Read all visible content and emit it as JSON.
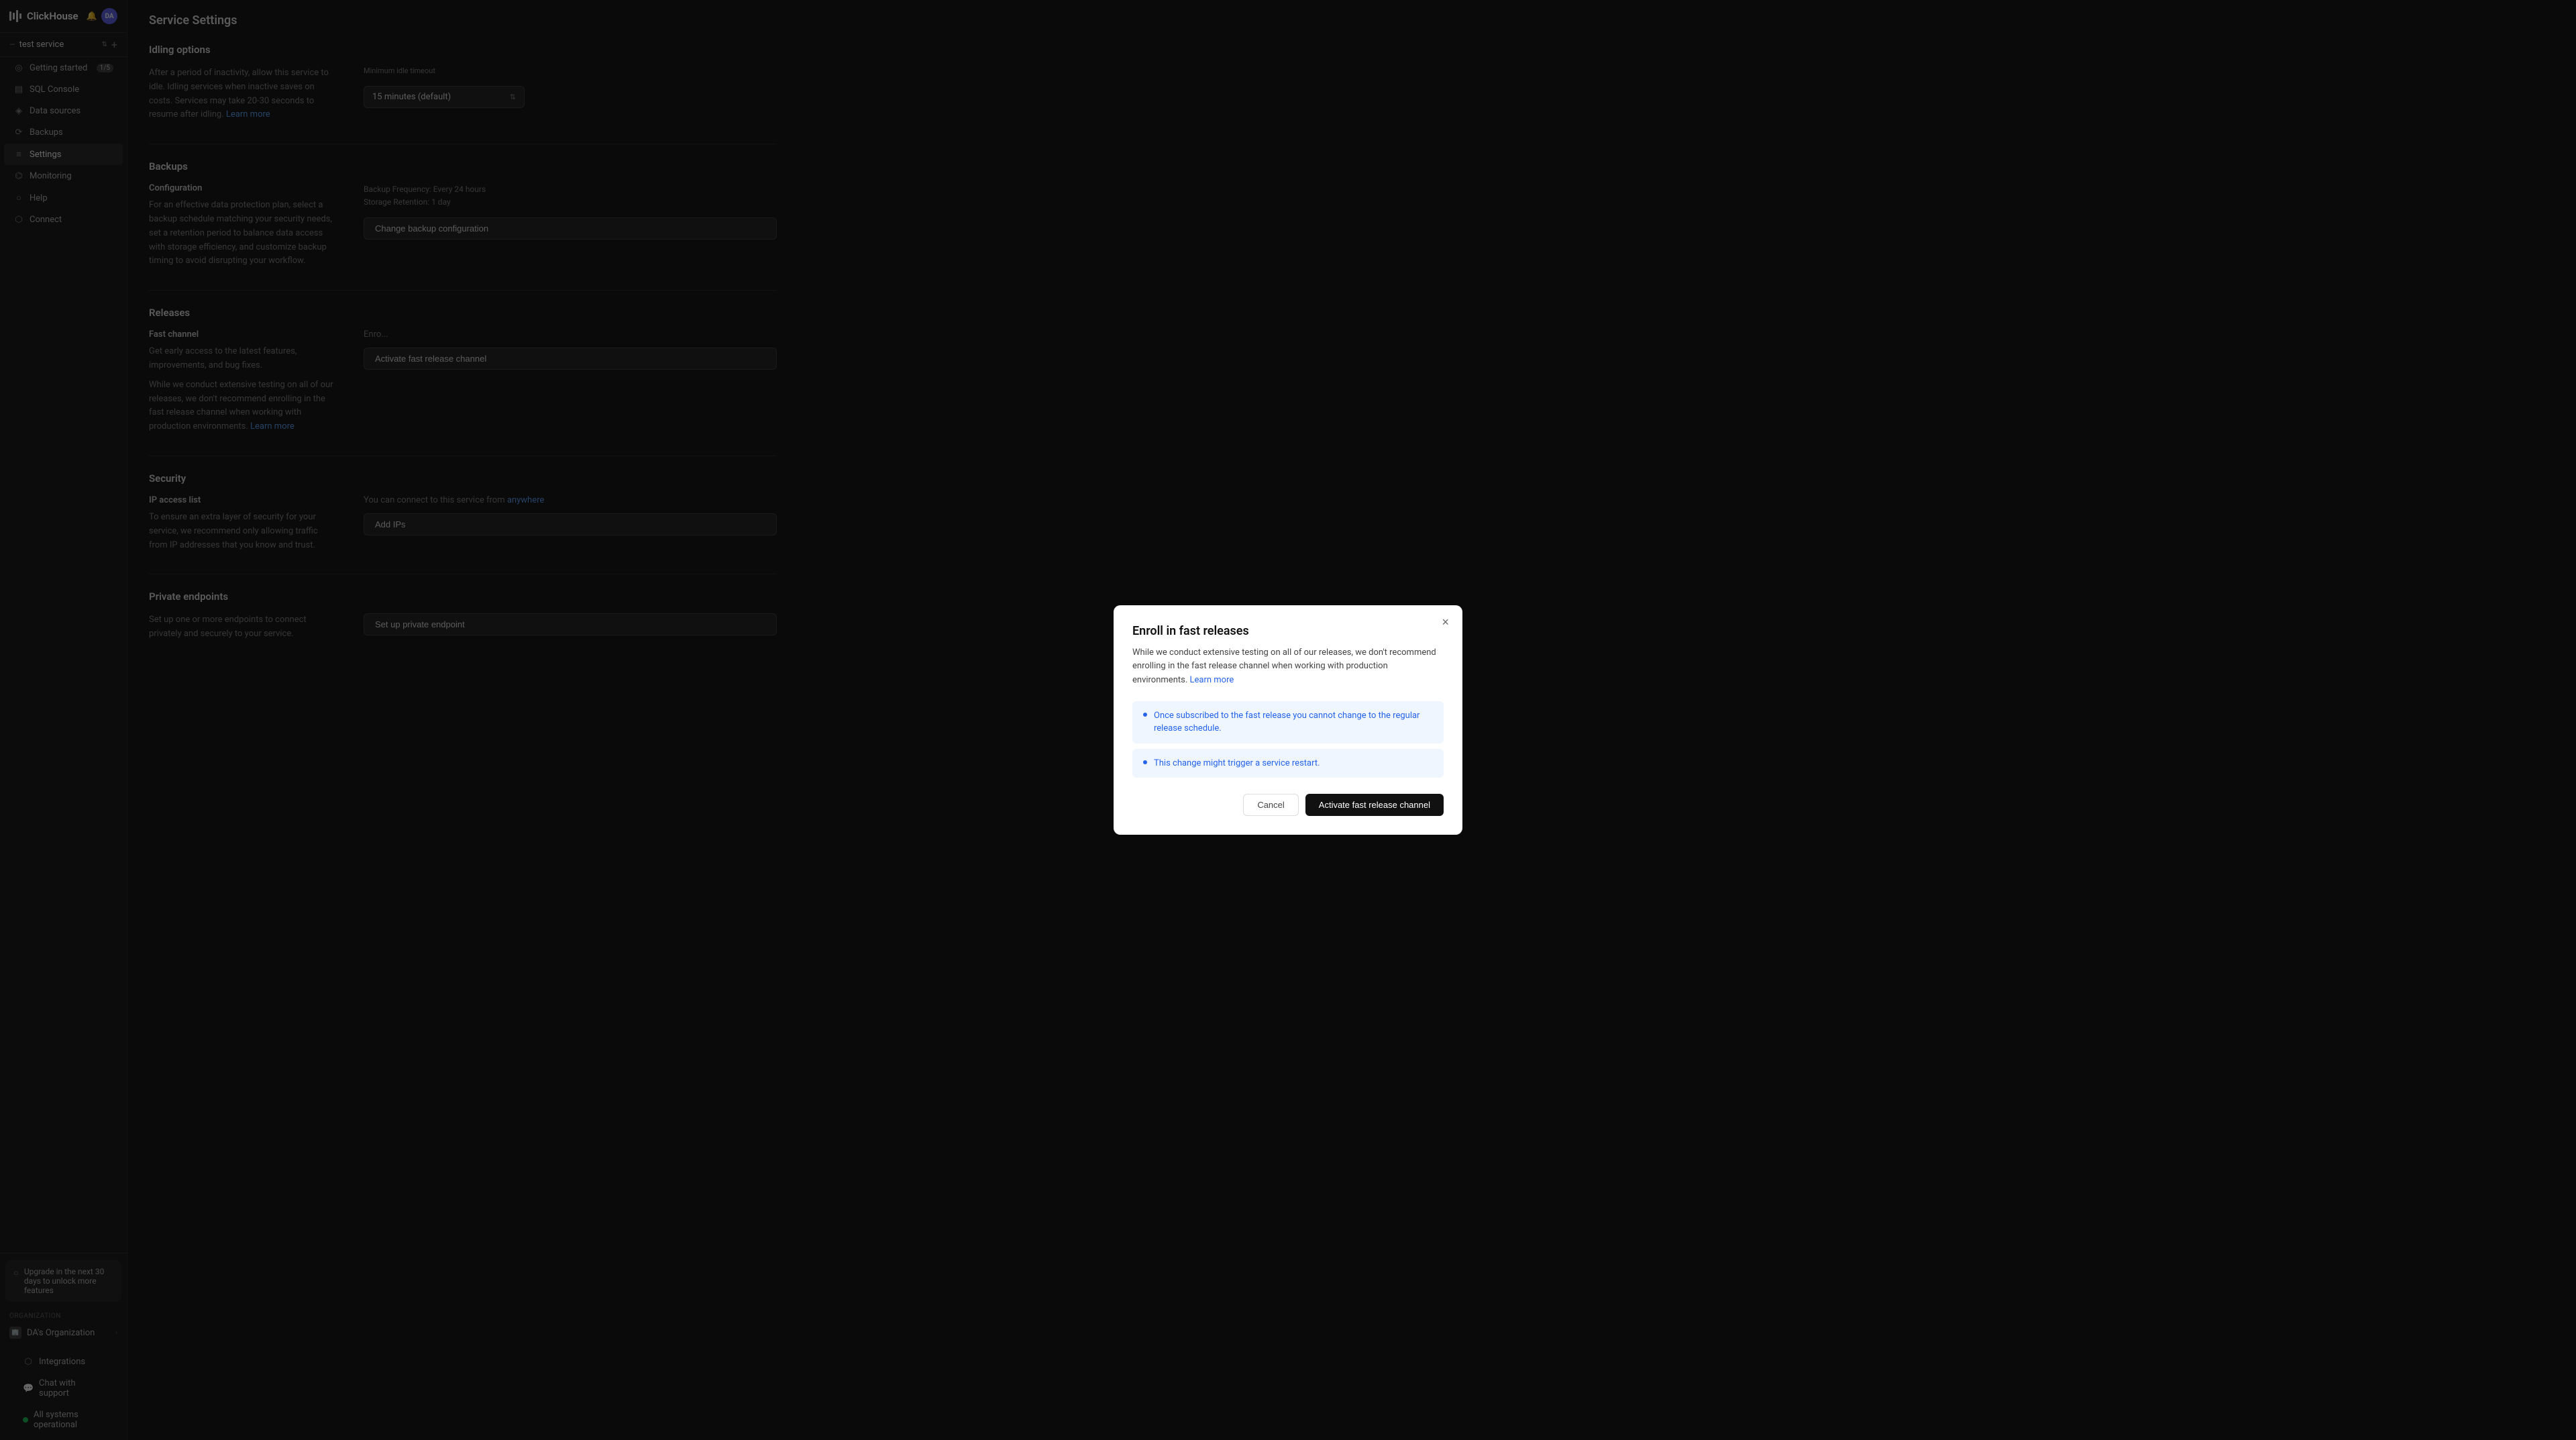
{
  "app": {
    "name": "ClickHouse",
    "logo_bars": [
      14,
      10,
      18,
      8
    ]
  },
  "header": {
    "bell_label": "🔔",
    "avatar_label": "DA"
  },
  "service": {
    "name": "test service",
    "add_label": "+"
  },
  "sidebar": {
    "nav_items": [
      {
        "id": "getting-started",
        "label": "Getting started",
        "icon": "◎",
        "badge": "1/5"
      },
      {
        "id": "sql-console",
        "label": "SQL Console",
        "icon": "▤"
      },
      {
        "id": "data-sources",
        "label": "Data sources",
        "icon": "◈"
      },
      {
        "id": "backups",
        "label": "Backups",
        "icon": "⟳"
      },
      {
        "id": "settings",
        "label": "Settings",
        "icon": "≡",
        "active": true
      },
      {
        "id": "monitoring",
        "label": "Monitoring",
        "icon": "⌬"
      },
      {
        "id": "help",
        "label": "Help",
        "icon": "○"
      },
      {
        "id": "connect",
        "label": "Connect",
        "icon": "⬡"
      }
    ],
    "upgrade": {
      "text": "Upgrade in the next 30 days to unlock more features"
    },
    "org": {
      "label": "Organization",
      "name": "DA's Organization"
    },
    "bottom_items": [
      {
        "id": "integrations",
        "label": "Integrations",
        "icon": "⬡"
      },
      {
        "id": "chat-support",
        "label": "Chat with support",
        "icon": "💬"
      },
      {
        "id": "status",
        "label": "All systems operational",
        "icon": "dot"
      }
    ]
  },
  "page": {
    "title": "Service Settings",
    "sections": {
      "idling": {
        "title": "Idling options",
        "desc": "After a period of inactivity, allow this service to idle. Idling services when inactive saves on costs. Services may take 20-30 seconds to resume after idling.",
        "learn_more": "Learn more",
        "field_label": "Minimum idle timeout",
        "select_value": "15 minutes (default)"
      },
      "backups": {
        "title": "Backups",
        "sub_title": "Configuration",
        "desc": "For an effective data protection plan, select a backup schedule matching your security needs, set a retention period to balance data access with storage efficiency, and customize backup timing to avoid disrupting your workflow.",
        "config_line1": "Backup Frequency: Every 24 hours",
        "config_line2": "Storage Retention: 1 day",
        "change_button": "Change backup configuration"
      },
      "releases": {
        "title": "Releases",
        "sub_title": "Fast channel",
        "desc1": "Get early access to the latest features, improvements, and bug fixes.",
        "desc2": "While we conduct extensive testing on all of our releases, we don't recommend enrolling in the fast release channel when working with production environments.",
        "learn_more": "Learn more",
        "enroll_label": "Enro...",
        "activate_label": "Activate fast release channel"
      },
      "security": {
        "title": "Security",
        "sub_title": "IP access list",
        "desc": "To ensure an extra layer of security for your service, we recommend only allowing traffic from IP addresses that you know and trust.",
        "connect_text": "You can connect to this service from",
        "anywhere_link": "anywhere",
        "add_ips_button": "Add IPs"
      },
      "private_endpoints": {
        "title": "Private endpoints",
        "desc": "Set up one or more endpoints to connect privately and securely to your service.",
        "setup_button": "Set up private endpoint"
      }
    }
  },
  "modal": {
    "title": "Enroll in fast releases",
    "desc": "While we conduct extensive testing on all of our releases, we don't recommend enrolling in the fast release channel when working with production environments.",
    "learn_more_text": "Learn more",
    "warnings": [
      {
        "text": "Once subscribed to the fast release you cannot change to the regular release schedule.",
        "has_link": false
      },
      {
        "text": "This change might trigger a service restart.",
        "has_link": false
      }
    ],
    "cancel_label": "Cancel",
    "confirm_label": "Activate fast release channel"
  }
}
